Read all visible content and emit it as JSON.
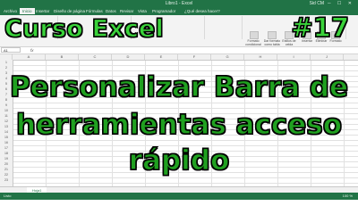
{
  "window": {
    "title": "Libro1 - Excel",
    "user": "Sid CM",
    "controls": "─ ☐ ✕"
  },
  "tabs": [
    "Archivo",
    "Inicio",
    "Insertar",
    "Diseño de página",
    "Fórmulas",
    "Datos",
    "Revisar",
    "Vista",
    "Programador",
    "¿Qué desea hacer?"
  ],
  "ribbon": {
    "buttons": [
      "Formato condicional",
      "Dar formato como tabla",
      "Estilos de celda",
      "Insertar",
      "Eliminar",
      "Formato"
    ]
  },
  "formula_bar": {
    "name_box": "A1",
    "fx": "fx"
  },
  "grid": {
    "columns": [
      "A",
      "B",
      "C",
      "D",
      "E",
      "F",
      "G",
      "H",
      "I",
      "J"
    ],
    "rows": [
      "1",
      "2",
      "3",
      "4",
      "5",
      "6",
      "7",
      "8",
      "9",
      "10",
      "11",
      "12",
      "13",
      "14",
      "15",
      "16",
      "17",
      "18",
      "19",
      "20",
      "21",
      "22",
      "23"
    ]
  },
  "sheet": {
    "tab": "Hoja1"
  },
  "status": {
    "ready": "Listo",
    "zoom": "100 %"
  },
  "overlay": {
    "series": "Curso Excel",
    "episode": "#17",
    "line1": "Personalizar Barra de",
    "line2": "herramientas acceso",
    "line3": "rápido"
  },
  "colors": {
    "excel_green": "#217346",
    "headline_green": "#3ad23a",
    "title_green": "#20a020"
  }
}
